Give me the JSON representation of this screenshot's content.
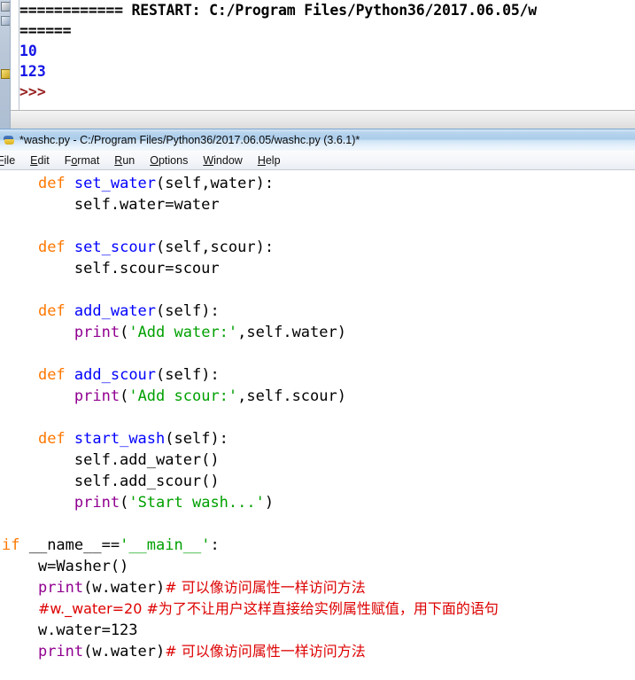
{
  "shell": {
    "lines": [
      {
        "kind": "restart",
        "text": "============ RESTART: C:/Program Files/Python36/2017.06.05/w"
      },
      {
        "kind": "restart",
        "text": "======"
      },
      {
        "kind": "out",
        "text": "10"
      },
      {
        "kind": "out",
        "text": "123"
      },
      {
        "kind": "prompt",
        "text": ">>>"
      }
    ]
  },
  "editor": {
    "title": "*washc.py - C:/Program Files/Python36/2017.06.05/washc.py (3.6.1)*",
    "menu": [
      {
        "label": "File",
        "mnemonic": "F"
      },
      {
        "label": "Edit",
        "mnemonic": "E"
      },
      {
        "label": "Format",
        "mnemonic": "o"
      },
      {
        "label": "Run",
        "mnemonic": "R"
      },
      {
        "label": "Options",
        "mnemonic": "O"
      },
      {
        "label": "Window",
        "mnemonic": "W"
      },
      {
        "label": "Help",
        "mnemonic": "H"
      }
    ],
    "code": [
      [
        {
          "t": "    ",
          "c": "pl"
        },
        {
          "t": "def ",
          "c": "kw"
        },
        {
          "t": "set_water",
          "c": "fn"
        },
        {
          "t": "(self,water):",
          "c": "pl"
        }
      ],
      [
        {
          "t": "        self.water=water",
          "c": "pl"
        }
      ],
      [
        {
          "t": "",
          "c": "pl"
        }
      ],
      [
        {
          "t": "    ",
          "c": "pl"
        },
        {
          "t": "def ",
          "c": "kw"
        },
        {
          "t": "set_scour",
          "c": "fn"
        },
        {
          "t": "(self,scour):",
          "c": "pl"
        }
      ],
      [
        {
          "t": "        self.scour=scour",
          "c": "pl"
        }
      ],
      [
        {
          "t": "",
          "c": "pl"
        }
      ],
      [
        {
          "t": "    ",
          "c": "pl"
        },
        {
          "t": "def ",
          "c": "kw"
        },
        {
          "t": "add_water",
          "c": "fn"
        },
        {
          "t": "(self):",
          "c": "pl"
        }
      ],
      [
        {
          "t": "        ",
          "c": "pl"
        },
        {
          "t": "print",
          "c": "bi"
        },
        {
          "t": "(",
          "c": "pl"
        },
        {
          "t": "'Add water:'",
          "c": "str"
        },
        {
          "t": ",self.water)",
          "c": "pl"
        }
      ],
      [
        {
          "t": "",
          "c": "pl"
        }
      ],
      [
        {
          "t": "    ",
          "c": "pl"
        },
        {
          "t": "def ",
          "c": "kw"
        },
        {
          "t": "add_scour",
          "c": "fn"
        },
        {
          "t": "(self):",
          "c": "pl"
        }
      ],
      [
        {
          "t": "        ",
          "c": "pl"
        },
        {
          "t": "print",
          "c": "bi"
        },
        {
          "t": "(",
          "c": "pl"
        },
        {
          "t": "'Add scour:'",
          "c": "str"
        },
        {
          "t": ",self.scour)",
          "c": "pl"
        }
      ],
      [
        {
          "t": "",
          "c": "pl"
        }
      ],
      [
        {
          "t": "    ",
          "c": "pl"
        },
        {
          "t": "def ",
          "c": "kw"
        },
        {
          "t": "start_wash",
          "c": "fn"
        },
        {
          "t": "(self):",
          "c": "pl"
        }
      ],
      [
        {
          "t": "        self.add_water()",
          "c": "pl"
        }
      ],
      [
        {
          "t": "        self.add_scour()",
          "c": "pl"
        }
      ],
      [
        {
          "t": "        ",
          "c": "pl"
        },
        {
          "t": "print",
          "c": "bi"
        },
        {
          "t": "(",
          "c": "pl"
        },
        {
          "t": "'Start wash...'",
          "c": "str"
        },
        {
          "t": ")",
          "c": "pl"
        }
      ],
      [
        {
          "t": "",
          "c": "pl"
        }
      ],
      [
        {
          "t": "if ",
          "c": "kw"
        },
        {
          "t": "__name__==",
          "c": "pl"
        },
        {
          "t": "'__main__'",
          "c": "str"
        },
        {
          "t": ":",
          "c": "pl"
        }
      ],
      [
        {
          "t": "    w=Washer()",
          "c": "pl"
        }
      ],
      [
        {
          "t": "    ",
          "c": "pl"
        },
        {
          "t": "print",
          "c": "bi"
        },
        {
          "t": "(w.water)",
          "c": "pl"
        },
        {
          "t": "# 可以像访问属性一样访问方法",
          "c": "cmt"
        }
      ],
      [
        {
          "t": "    ",
          "c": "pl"
        },
        {
          "t": "#w._water=20 #为了不让用户这样直接给实例属性赋值，用下面的语句",
          "c": "cmt"
        }
      ],
      [
        {
          "t": "    w.water=123",
          "c": "pl"
        }
      ],
      [
        {
          "t": "    ",
          "c": "pl"
        },
        {
          "t": "print",
          "c": "bi"
        },
        {
          "t": "(w.water)",
          "c": "pl"
        },
        {
          "t": "# 可以像访问属性一样访问方法",
          "c": "cmt"
        }
      ]
    ]
  },
  "colors": {
    "keyword": "#ff7700",
    "function": "#0000ff",
    "builtin": "#900090",
    "string": "#00a000",
    "comment": "#dd0000",
    "shell_output": "#1414e6",
    "shell_prompt": "#992222"
  }
}
